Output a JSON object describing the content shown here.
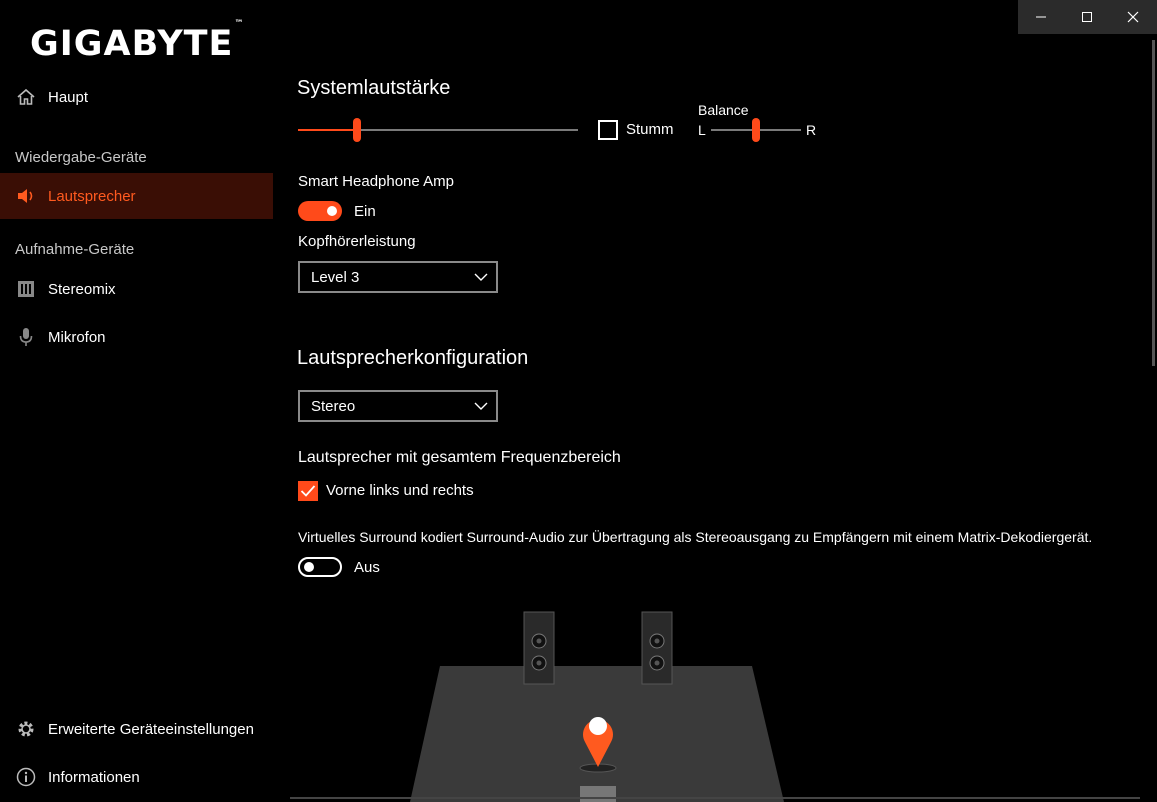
{
  "brand": {
    "logo_text": "GIGABYTE",
    "trademark": "™"
  },
  "window_controls": {
    "minimize": "minimize-icon",
    "maximize": "maximize-icon",
    "close": "close-icon"
  },
  "sidebar": {
    "home": {
      "label": "Haupt",
      "icon": "home-icon"
    },
    "playback_section": "Wiedergabe-Geräte",
    "playback_items": [
      {
        "label": "Lautsprecher",
        "icon": "speaker-icon",
        "active": true
      }
    ],
    "recording_section": "Aufnahme-Geräte",
    "recording_items": [
      {
        "label": "Stereomix",
        "icon": "stereomix-icon"
      },
      {
        "label": "Mikrofon",
        "icon": "microphone-icon"
      }
    ],
    "footer_items": [
      {
        "label": "Erweiterte Geräteeinstellungen",
        "icon": "gear-icon"
      },
      {
        "label": "Informationen",
        "icon": "info-icon"
      }
    ]
  },
  "main": {
    "system_volume": {
      "title": "Systemlautstärke",
      "volume_level_fraction": 0.21,
      "mute_label": "Stumm",
      "mute_checked": false,
      "balance_label": "Balance",
      "balance_left": "L",
      "balance_right": "R",
      "balance_position_fraction": 0.5
    },
    "smart_amp": {
      "label": "Smart Headphone Amp",
      "toggle_state_label": "Ein",
      "enabled": true,
      "power_label": "Kopfhörerleistung",
      "power_value": "Level 3"
    },
    "speaker_config": {
      "title": "Lautsprecherkonfiguration",
      "value": "Stereo",
      "fullrange_title": "Lautsprecher mit gesamtem Frequenzbereich",
      "fullrange_option": "Vorne links und rechts",
      "fullrange_checked": true,
      "surround_desc": "Virtuelles Surround kodiert Surround-Audio zur Übertragung als Stereoausgang zu Empfängern mit einem Matrix-Dekodiergerät.",
      "surround_state_label": "Aus",
      "surround_enabled": false
    }
  },
  "colors": {
    "accent": "#ff4a1a",
    "active_bg": "#3a0e05",
    "background": "#000000"
  }
}
